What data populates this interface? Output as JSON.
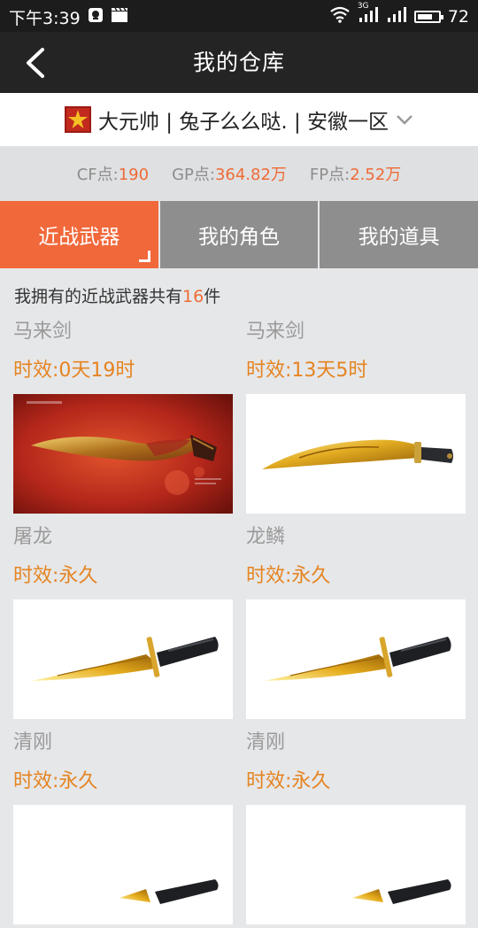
{
  "status_bar": {
    "time": "下午3:39",
    "network_label": "3G",
    "battery": "72",
    "battery_level": 0.72
  },
  "header": {
    "title": "我的仓库"
  },
  "account": {
    "text": "大元帅 | 兔子么么哒. | 安徽一区"
  },
  "points": {
    "cf_label": "CF点:",
    "cf_value": "190",
    "gp_label": "GP点:",
    "gp_value": "364.82万",
    "fp_label": "FP点:",
    "fp_value": "2.52万"
  },
  "tabs": [
    {
      "label": "近战武器",
      "active": true
    },
    {
      "label": "我的角色",
      "active": false
    },
    {
      "label": "我的道具",
      "active": false
    }
  ],
  "summary": {
    "prefix": "我拥有的近战武器共有",
    "count": "16",
    "suffix": "件"
  },
  "items": [
    {
      "name": "马来剑",
      "duration": "时效:0天19时",
      "image": "malay-sword-red"
    },
    {
      "name": "马来剑",
      "duration": "时效:13天5时",
      "image": "malay-sword-gold"
    },
    {
      "name": "屠龙",
      "duration": "时效:永久",
      "image": "dragon-knife"
    },
    {
      "name": "龙鳞",
      "duration": "时效:永久",
      "image": "dragon-knife"
    },
    {
      "name": "清刚",
      "duration": "时效:永久",
      "image": "dragon-knife"
    },
    {
      "name": "清刚",
      "duration": "时效:永久",
      "image": "dragon-knife"
    }
  ],
  "colors": {
    "accent": "#f1683a",
    "duration": "#e58421",
    "titlebar": "#242424",
    "tab_inactive": "#8e8e8e"
  }
}
